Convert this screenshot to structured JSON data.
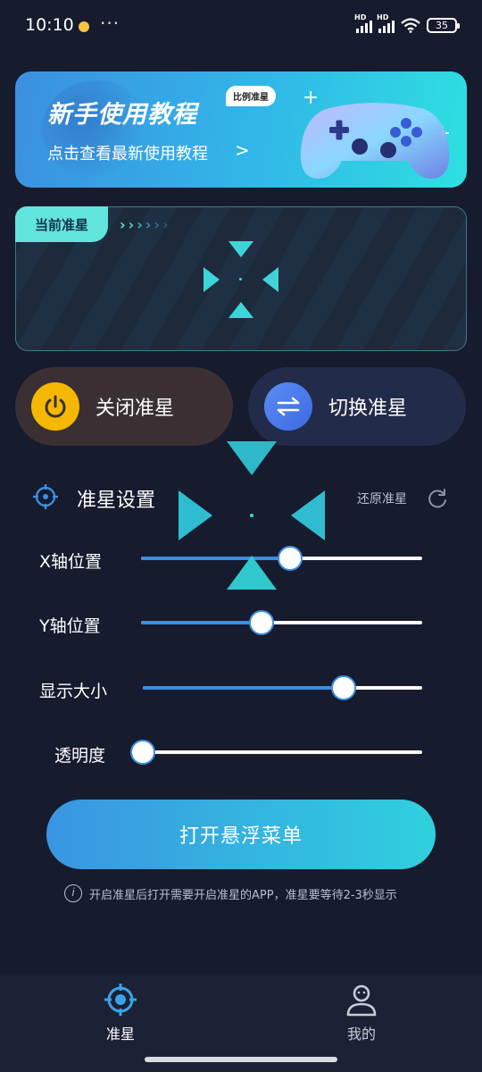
{
  "status_bar": {
    "time": "10:10",
    "more": "···",
    "signal_label_1": "HD",
    "signal_label_2": "HD",
    "battery": "35"
  },
  "banner": {
    "title": "新手使用教程",
    "badge": "比例准星",
    "subtitle": "点击查看最新使用教程",
    "chevron": ">"
  },
  "current": {
    "tag": "当前准星",
    "arrows": [
      "›",
      "›",
      "›",
      "›",
      "›",
      "›"
    ]
  },
  "actions": {
    "off_label": "关闭准星",
    "switch_label": "切换准星"
  },
  "settings": {
    "title": "准星设置",
    "reset_label": "还原准星",
    "rows": [
      {
        "label": "X轴位置",
        "value": 0.53
      },
      {
        "label": "Y轴位置",
        "value": 0.43
      },
      {
        "label": "显示大小",
        "value": 0.72
      },
      {
        "label": "透明度",
        "value": 0.0
      }
    ]
  },
  "float_button": "打开悬浮菜单",
  "hint": {
    "icon": "i",
    "text": "开启准星后打开需要开启准星的APP，准星要等待2-3秒显示"
  },
  "tabs": [
    {
      "label": "准星",
      "icon": "crosshair-icon",
      "active": true
    },
    {
      "label": "我的",
      "icon": "user-icon",
      "active": false
    }
  ],
  "colors": {
    "background": "#161b2e",
    "accent_blue": "#3a8fe0",
    "accent_cyan": "#2fd0de",
    "power_yellow": "#f5b800",
    "tab_active": "#3aa3e8",
    "tab_inactive": "#c8ccd6"
  }
}
